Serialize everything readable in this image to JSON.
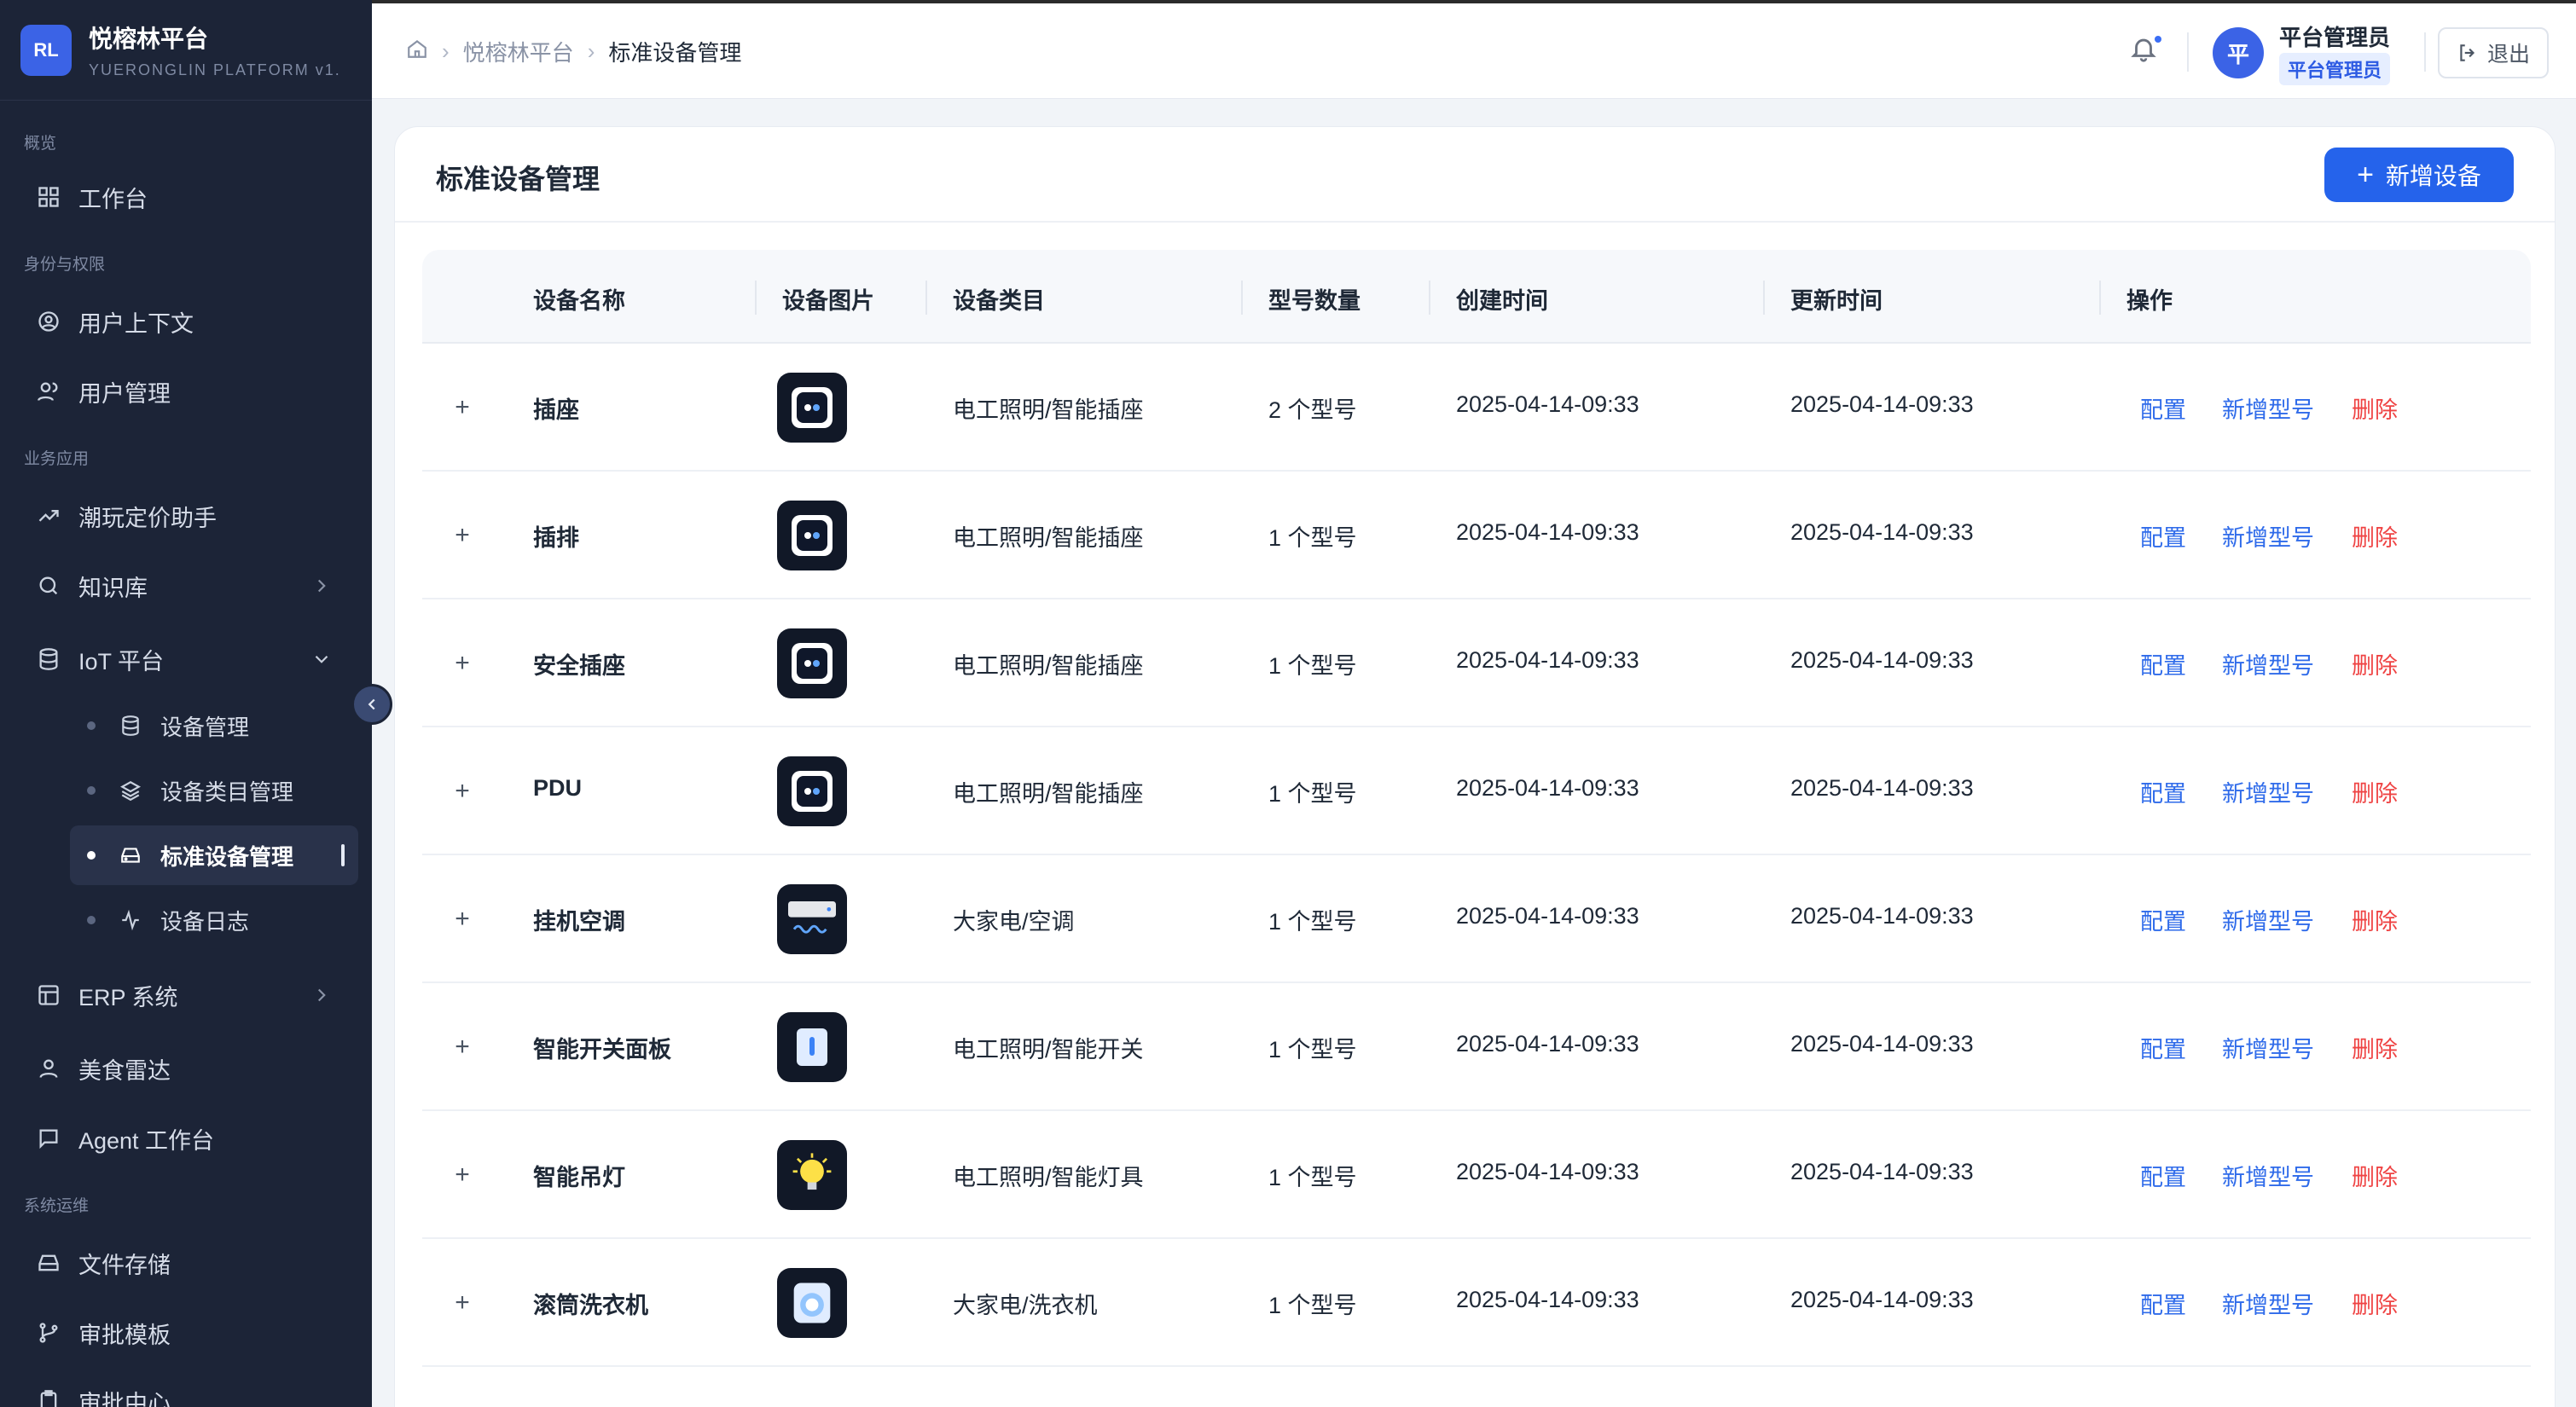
{
  "brand": {
    "logo": "RL",
    "name": "悦榕林平台",
    "subtitle": "YUERONGLIN PLATFORM v1."
  },
  "sidebar": {
    "sections": [
      "概览",
      "身份与权限",
      "业务应用",
      "系统运维"
    ],
    "items": [
      {
        "label": "工作台",
        "icon": "grid-icon"
      },
      {
        "label": "用户上下文",
        "icon": "user-circle-icon"
      },
      {
        "label": "用户管理",
        "icon": "users-icon"
      },
      {
        "label": "潮玩定价助手",
        "icon": "trend-icon"
      },
      {
        "label": "知识库",
        "icon": "search-icon"
      },
      {
        "label": "IoT 平台",
        "icon": "database-icon"
      },
      {
        "label": "ERP 系统",
        "icon": "layout-icon"
      },
      {
        "label": "美食雷达",
        "icon": "user-icon"
      },
      {
        "label": "Agent 工作台",
        "icon": "chat-icon"
      },
      {
        "label": "文件存储",
        "icon": "storage-icon"
      },
      {
        "label": "审批模板",
        "icon": "branch-icon"
      },
      {
        "label": "审批中心",
        "icon": "clipboard-icon"
      }
    ],
    "iot_sub": [
      {
        "label": "设备管理",
        "icon": "database-icon"
      },
      {
        "label": "设备类目管理",
        "icon": "layers-icon"
      },
      {
        "label": "标准设备管理",
        "icon": "drive-icon"
      },
      {
        "label": "设备日志",
        "icon": "activity-icon"
      }
    ]
  },
  "header": {
    "breadcrumb": [
      "悦榕林平台",
      "标准设备管理"
    ],
    "user_initial": "平",
    "user_name": "平台管理员",
    "user_role": "平台管理员",
    "logout": "退出"
  },
  "page": {
    "title": "标准设备管理",
    "add_button": "新增设备"
  },
  "table": {
    "columns": [
      "设备名称",
      "设备图片",
      "设备类目",
      "型号数量",
      "创建时间",
      "更新时间",
      "操作"
    ],
    "actions": {
      "config": "配置",
      "add_model": "新增型号",
      "delete": "删除"
    },
    "rows": [
      {
        "name": "插座",
        "category": "电工照明/智能插座",
        "models": "2 个型号",
        "created": "2025-04-14-09:33",
        "updated": "2025-04-14-09:33",
        "image": "socket-icon"
      },
      {
        "name": "插排",
        "category": "电工照明/智能插座",
        "models": "1 个型号",
        "created": "2025-04-14-09:33",
        "updated": "2025-04-14-09:33",
        "image": "socket-icon"
      },
      {
        "name": "安全插座",
        "category": "电工照明/智能插座",
        "models": "1 个型号",
        "created": "2025-04-14-09:33",
        "updated": "2025-04-14-09:33",
        "image": "socket-icon"
      },
      {
        "name": "PDU",
        "category": "电工照明/智能插座",
        "models": "1 个型号",
        "created": "2025-04-14-09:33",
        "updated": "2025-04-14-09:33",
        "image": "socket-icon"
      },
      {
        "name": "挂机空调",
        "category": "大家电/空调",
        "models": "1 个型号",
        "created": "2025-04-14-09:33",
        "updated": "2025-04-14-09:33",
        "image": "air-conditioner-icon"
      },
      {
        "name": "智能开关面板",
        "category": "电工照明/智能开关",
        "models": "1 个型号",
        "created": "2025-04-14-09:33",
        "updated": "2025-04-14-09:33",
        "image": "switch-icon"
      },
      {
        "name": "智能吊灯",
        "category": "电工照明/智能灯具",
        "models": "1 个型号",
        "created": "2025-04-14-09:33",
        "updated": "2025-04-14-09:33",
        "image": "bulb-icon"
      },
      {
        "name": "滚筒洗衣机",
        "category": "大家电/洗衣机",
        "models": "1 个型号",
        "created": "2025-04-14-09:33",
        "updated": "2025-04-14-09:33",
        "image": "washer-icon"
      }
    ]
  }
}
